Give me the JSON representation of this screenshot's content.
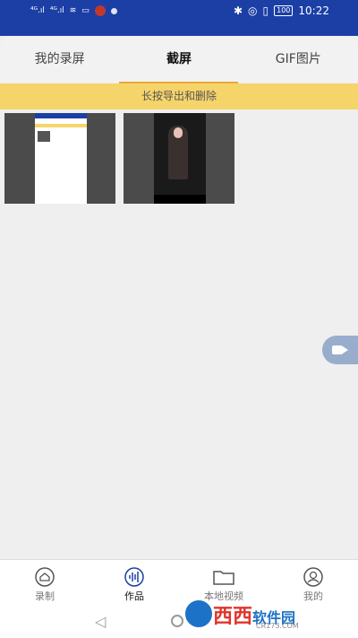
{
  "status_bar": {
    "signal_1": "⁴ᴳ.ıl",
    "signal_2": "⁴ᴳ.ıl",
    "battery": "100",
    "time": "10:22"
  },
  "tabs": [
    {
      "label": "我的录屏",
      "active": false
    },
    {
      "label": "截屏",
      "active": true
    },
    {
      "label": "GIF图片",
      "active": false
    }
  ],
  "notice": "长按导出和删除",
  "bottom_nav": [
    {
      "label": "录制",
      "icon": "home-icon",
      "active": false
    },
    {
      "label": "作品",
      "icon": "waveform-icon",
      "active": true
    },
    {
      "label": "本地视频",
      "icon": "folder-icon",
      "active": false
    },
    {
      "label": "我的",
      "icon": "user-icon",
      "active": false
    }
  ],
  "watermark": {
    "brand": "西西",
    "suffix": "软件园",
    "url": "CR173.COM"
  },
  "colors": {
    "header": "#1c3fa6",
    "notice": "#f5d46a",
    "tab_indicator": "#e9a83a"
  }
}
